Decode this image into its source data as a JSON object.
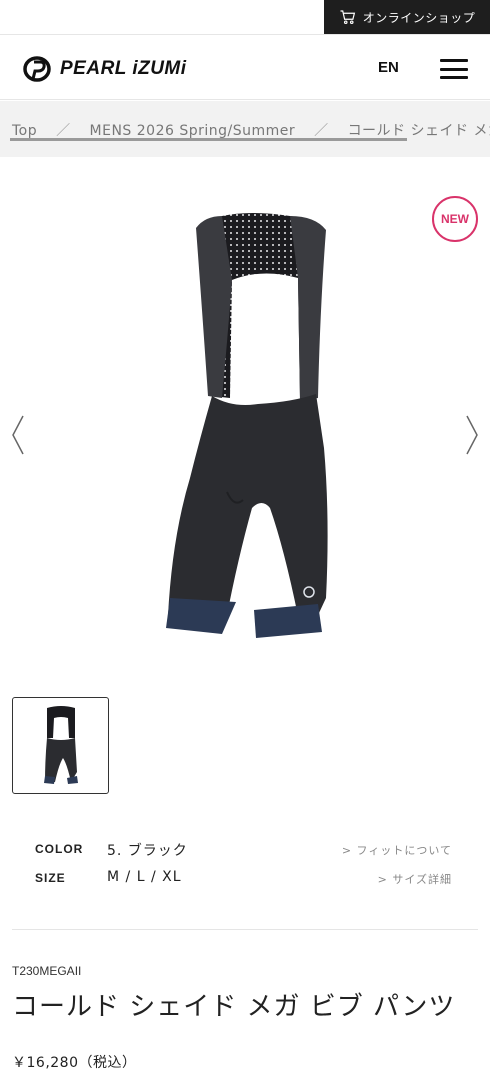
{
  "topbar": {
    "cart_label": "オンラインショップ",
    "cart_icon": "cart-icon"
  },
  "header": {
    "logo_text": "PEARL iZUMi",
    "lang_label": "EN",
    "menu_icon": "hamburger-icon"
  },
  "breadcrumb": {
    "items": [
      "Top",
      "MENS 2026 Spring/Summer",
      "コールド シェイド メガ ビブ パンツ"
    ]
  },
  "gallery": {
    "badge": "NEW",
    "prev_icon": "chevron-left-icon",
    "next_icon": "chevron-right-icon",
    "current_index": 1,
    "total": 1
  },
  "specs": {
    "color_label": "COLOR",
    "color_value": "5. ブラック",
    "fit_link": "> フィットについて",
    "size_label": "SIZE",
    "size_value": "M / L / XL",
    "size_link": "> サイズ詳細"
  },
  "product": {
    "code": "T230MEGAII",
    "title": "コールド シェイド メガ ビブ パンツ",
    "price": "￥16,280（税込）"
  },
  "colors": {
    "badge": "#d9336a",
    "dark": "#1e1e1e",
    "garment": "#2b2c30",
    "hem": "#2c3a55"
  }
}
